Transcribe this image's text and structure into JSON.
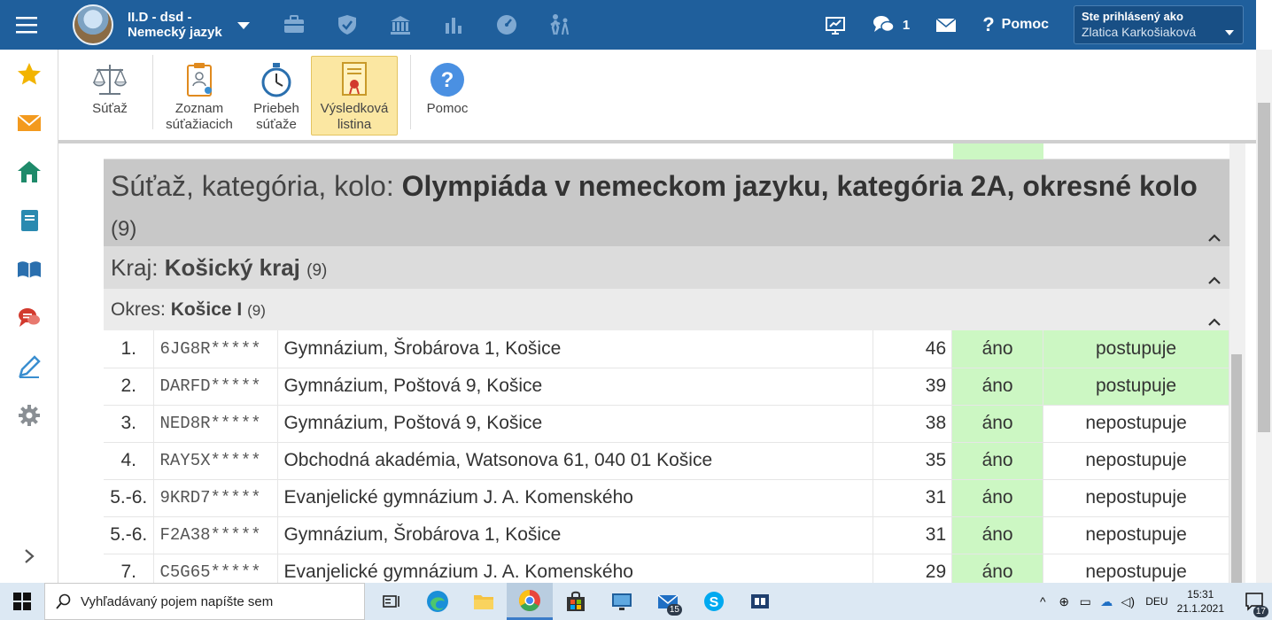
{
  "topbar": {
    "class_title_line1": "II.D - dsd -",
    "class_title_line2": "Nemecký jazyk",
    "messages_count": "1",
    "help_label": "Pomoc",
    "user_label": "Ste prihlásený ako",
    "user_name": "Zlatica Karkošiaková",
    "icons": [
      "briefcase-icon",
      "shield-icon",
      "institution-icon",
      "bar-chart-icon",
      "speedometer-icon",
      "students-icon"
    ]
  },
  "sidebar": {
    "icons": [
      "star-icon",
      "mail-icon",
      "home-icon",
      "notebook-icon",
      "book-icon",
      "chat-icon",
      "pencil-icon",
      "gear-icon"
    ]
  },
  "toolbar": {
    "items": [
      {
        "label1": "Súťaž",
        "label2": ""
      },
      {
        "label1": "Zoznam",
        "label2": "súťažiacich"
      },
      {
        "label1": "Priebeh",
        "label2": "súťaže"
      },
      {
        "label1": "Výsledková",
        "label2": "listina"
      },
      {
        "label1": "Pomoc",
        "label2": ""
      }
    ]
  },
  "groups": {
    "competition_prefix": "Súťaž, kategória, kolo: ",
    "competition_name": "Olympiáda v nemeckom jazyku, kategória 2A, okresné kolo",
    "competition_count": "(9)",
    "region_prefix": "Kraj: ",
    "region_name": "Košický kraj",
    "region_count": "(9)",
    "district_prefix": "Okres: ",
    "district_name": "Košice I",
    "district_count": "(9)"
  },
  "results": [
    {
      "rank": "1.",
      "code": "6JG8R*****",
      "school": "Gymnázium, Šrobárova 1, Košice",
      "score": "46",
      "ok": "áno",
      "status": "postupuje",
      "advances": true
    },
    {
      "rank": "2.",
      "code": "DARFD*****",
      "school": "Gymnázium, Poštová 9, Košice",
      "score": "39",
      "ok": "áno",
      "status": "postupuje",
      "advances": true
    },
    {
      "rank": "3.",
      "code": "NED8R*****",
      "school": "Gymnázium, Poštová 9, Košice",
      "score": "38",
      "ok": "áno",
      "status": "nepostupuje",
      "advances": false
    },
    {
      "rank": "4.",
      "code": "RAY5X*****",
      "school": "Obchodná akadémia, Watsonova 61, 040 01 Košice",
      "score": "35",
      "ok": "áno",
      "status": "nepostupuje",
      "advances": false
    },
    {
      "rank": "5.-6.",
      "code": "9KRD7*****",
      "school": "Evanjelické gymnázium J. A. Komenského",
      "score": "31",
      "ok": "áno",
      "status": "nepostupuje",
      "advances": false
    },
    {
      "rank": "5.-6.",
      "code": "F2A38*****",
      "school": "Gymnázium, Šrobárova 1, Košice",
      "score": "31",
      "ok": "áno",
      "status": "nepostupuje",
      "advances": false
    },
    {
      "rank": "7.",
      "code": "C5G65*****",
      "school": "Evanjelické gymnázium J. A. Komenského",
      "score": "29",
      "ok": "áno",
      "status": "nepostupuje",
      "advances": false
    }
  ],
  "taskbar": {
    "search_placeholder": "Vyhľadávaný pojem napíšte sem",
    "mail_badge": "15",
    "language": "DEU",
    "time": "15:31",
    "date": "21.1.2021",
    "notifications": "17"
  },
  "colors": {
    "topbar": "#1f5f9c",
    "advance_green": "#ccf7c3",
    "active_tool": "#fbe7a2",
    "sidebar_icon": "#2a8ab0"
  }
}
